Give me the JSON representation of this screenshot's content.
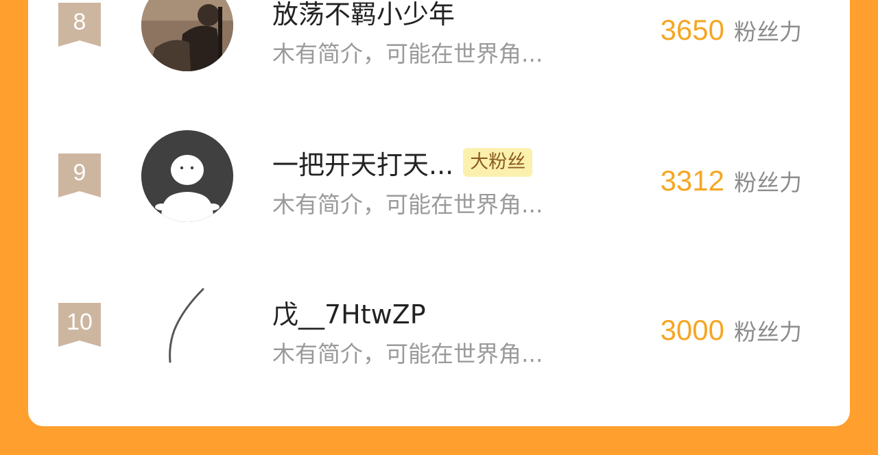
{
  "ranking": {
    "items": [
      {
        "rank": "8",
        "name": "放荡不羁小少年",
        "intro": "木有简介，可能在世界角...",
        "score": "3650",
        "score_label": "粉丝力",
        "badge": "",
        "avatar": "photo-avatar"
      },
      {
        "rank": "9",
        "name": "一把开天打天...",
        "intro": "木有简介，可能在世界角...",
        "score": "3312",
        "score_label": "粉丝力",
        "badge": "大粉丝",
        "avatar": "default-avatar"
      },
      {
        "rank": "10",
        "name": "戊__7HtwZP",
        "intro": "木有简介，可能在世界角...",
        "score": "3000",
        "score_label": "粉丝力",
        "badge": "",
        "avatar": "sketch-avatar"
      }
    ]
  }
}
